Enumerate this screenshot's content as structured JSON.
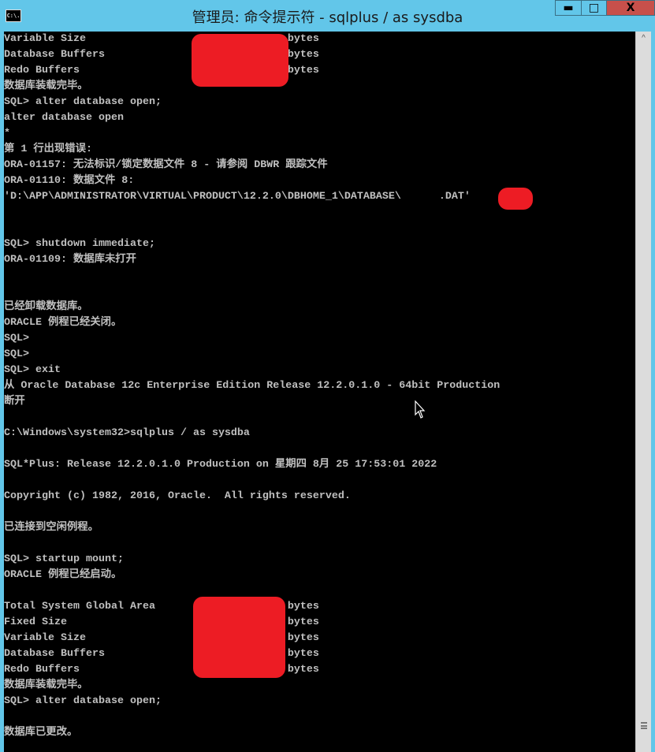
{
  "window": {
    "title": "管理员: 命令提示符 - sqlplus  / as sysdba",
    "icon_label": "C:\\.",
    "minimize": "▬",
    "maximize": "□",
    "close": "X"
  },
  "colors": {
    "titlebar": "#62c6e9",
    "console_bg": "#000000",
    "console_text": "#c0c0c0",
    "redaction": "#ed1c24",
    "close_button": "#c7504b"
  },
  "console": {
    "lines": [
      "Variable Size                                bytes",
      "Database Buffers                             bytes",
      "Redo Buffers                                 bytes",
      "数据库装载完毕。",
      "SQL> alter database open;",
      "alter database open",
      "*",
      "第 1 行出现错误:",
      "ORA-01157: 无法标识/锁定数据文件 8 - 请参阅 DBWR 跟踪文件",
      "ORA-01110: 数据文件 8:",
      "'D:\\APP\\ADMINISTRATOR\\VIRTUAL\\PRODUCT\\12.2.0\\DBHOME_1\\DATABASE\\      .DAT'",
      "",
      "",
      "SQL> shutdown immediate;",
      "ORA-01109: 数据库未打开",
      "",
      "",
      "已经卸载数据库。",
      "ORACLE 例程已经关闭。",
      "SQL>",
      "SQL>",
      "SQL> exit",
      "从 Oracle Database 12c Enterprise Edition Release 12.2.0.1.0 - 64bit Production",
      "断开",
      "",
      "C:\\Windows\\system32>sqlplus / as sysdba",
      "",
      "SQL*Plus: Release 12.2.0.1.0 Production on 星期四 8月 25 17:53:01 2022",
      "",
      "Copyright (c) 1982, 2016, Oracle.  All rights reserved.",
      "",
      "已连接到空闲例程。",
      "",
      "SQL> startup mount;",
      "ORACLE 例程已经启动。",
      "",
      "Total System Global Area                     bytes",
      "Fixed Size                                   bytes",
      "Variable Size                                bytes",
      "Database Buffers                             bytes",
      "Redo Buffers                                 bytes",
      "数据库装载完毕。",
      "SQL> alter database open;",
      "",
      "数据库已更改。"
    ]
  }
}
